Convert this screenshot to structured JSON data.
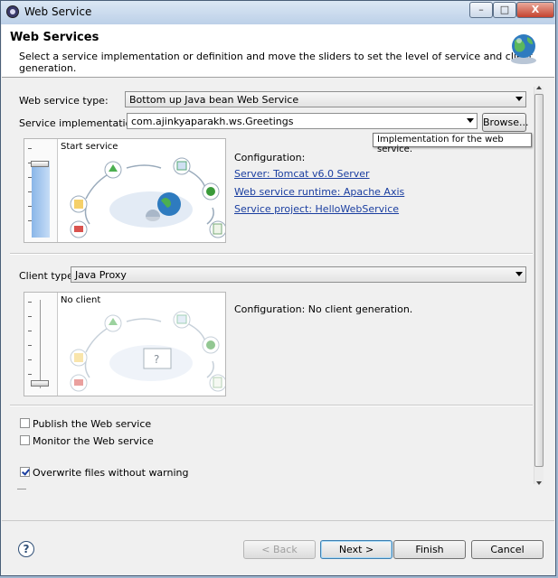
{
  "window": {
    "title": "Web Service",
    "min_label": "–",
    "max_label": "□",
    "close_label": "X"
  },
  "header": {
    "title": "Web Services",
    "description": "Select a service implementation or definition and move the sliders to set the level of service and client generation."
  },
  "service": {
    "type_label": "Web service type:",
    "type_value": "Bottom up Java bean Web Service",
    "impl_label": "Service implementation:",
    "impl_value": "com.ajinkyaparakh.ws.Greetings",
    "browse_label": "Browse...",
    "tooltip": "Implementation for the web service.",
    "panel_title": "Start service",
    "config_label": "Configuration:",
    "links": [
      "Server: Tomcat v6.0 Server",
      "Web service runtime: Apache Axis",
      "Service project: HelloWebService"
    ]
  },
  "client": {
    "type_label": "Client type:",
    "type_value": "Java Proxy",
    "panel_title": "No client",
    "config_text": "Configuration: No client generation."
  },
  "options": [
    {
      "label": "Publish the Web service",
      "checked": false
    },
    {
      "label": "Monitor the Web service",
      "checked": false
    },
    {
      "label": "Overwrite files without warning",
      "checked": true
    }
  ],
  "buttons": {
    "back": "< Back",
    "next": "Next >",
    "finish": "Finish",
    "cancel": "Cancel"
  },
  "icons": {
    "help": "help-icon",
    "globe": "globe-icon",
    "app": "eclipse-icon"
  }
}
